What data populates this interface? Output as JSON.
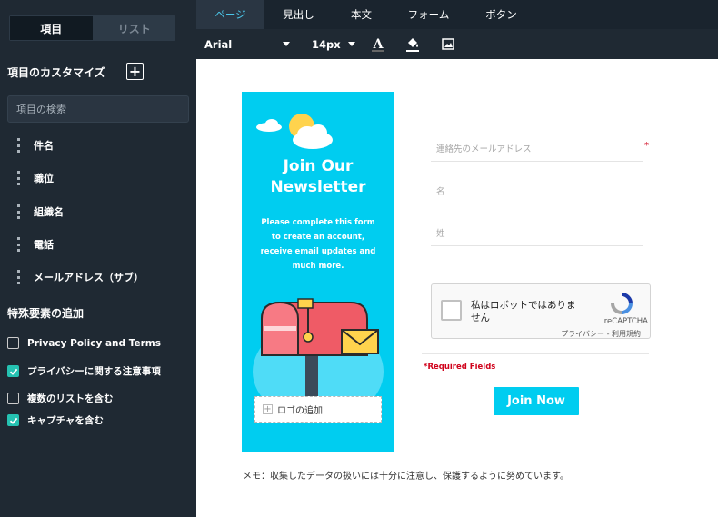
{
  "sidebar": {
    "segments": [
      "項目",
      "リスト"
    ],
    "customize_title": "項目のカスタマイズ",
    "add_label": "+",
    "search_placeholder": "項目の検索",
    "items": [
      "件名",
      "職位",
      "組織名",
      "電話",
      "メールアドレス（サブ）"
    ],
    "special_title": "特殊要素の追加",
    "checkboxes": [
      {
        "label": "Privacy Policy and Terms",
        "checked": false
      },
      {
        "label": "プライバシーに関する注意事項",
        "checked": true
      },
      {
        "label": "複数のリストを含む",
        "checked": false
      },
      {
        "label": "キャプチャを含む",
        "checked": true
      }
    ]
  },
  "tabs": [
    "ページ",
    "見出し",
    "本文",
    "フォーム",
    "ボタン"
  ],
  "toolbar": {
    "font": "Arial",
    "size": "14px",
    "icons": [
      "text-color-icon",
      "fill-color-icon",
      "image-icon"
    ]
  },
  "banner": {
    "title_line1": "Join Our",
    "title_line2": "Newsletter",
    "subtitle": "Please complete this form to create an account, receive email updates and much more.",
    "logo_label": "ロゴの追加",
    "bg_color": "#00cdf0"
  },
  "form": {
    "email_placeholder": "連絡先のメールアドレス",
    "first_name_placeholder": "名",
    "last_name_placeholder": "姓",
    "required_star": "*",
    "captcha_text": "私はロボットではありません",
    "captcha_brand": "reCAPTCHA",
    "captcha_links": "プライバシー - 利用規約",
    "required_note": "*Required Fields",
    "button_label": "Join Now"
  },
  "memo": "メモ：収集したデータの扱いには十分に注意し、保護するように努めています。",
  "colors": {
    "accent": "#00cdf0",
    "sidebar": "#1f2933",
    "check": "#25c2b2",
    "required": "#d0021b"
  }
}
